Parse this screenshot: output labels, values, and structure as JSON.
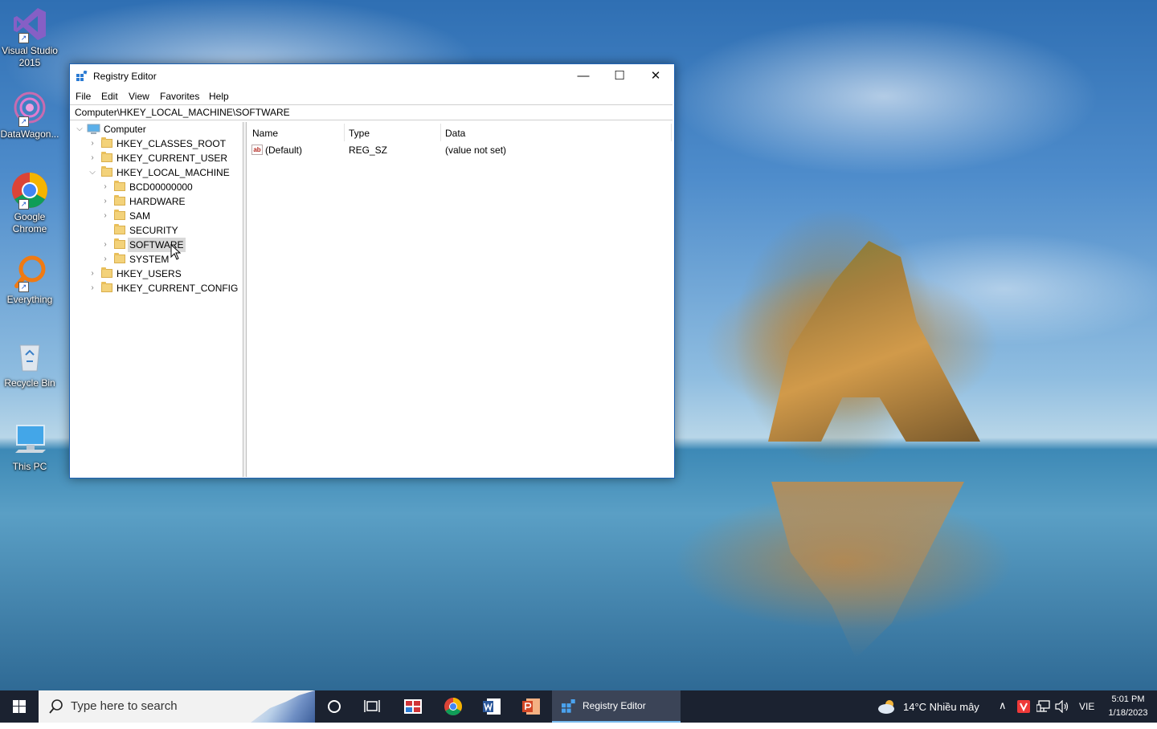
{
  "desktop": {
    "icons": [
      {
        "label": "Visual Studio 2015"
      },
      {
        "label": "DataWagon..."
      },
      {
        "label": "Google Chrome"
      },
      {
        "label": "Everything"
      },
      {
        "label": "Recycle Bin"
      },
      {
        "label": "This PC"
      }
    ]
  },
  "window": {
    "title": "Registry Editor",
    "minimize_glyph": "—",
    "maximize_glyph": "☐",
    "close_glyph": "✕",
    "menu": [
      "File",
      "Edit",
      "View",
      "Favorites",
      "Help"
    ],
    "address": "Computer\\HKEY_LOCAL_MACHINE\\SOFTWARE",
    "tree": {
      "root": "Computer",
      "hives": [
        "HKEY_CLASSES_ROOT",
        "HKEY_CURRENT_USER",
        "HKEY_LOCAL_MACHINE",
        "HKEY_USERS",
        "HKEY_CURRENT_CONFIG"
      ],
      "hklm_children": [
        "BCD00000000",
        "HARDWARE",
        "SAM",
        "SECURITY",
        "SOFTWARE",
        "SYSTEM"
      ],
      "selected": "SOFTWARE"
    },
    "list": {
      "columns": [
        "Name",
        "Type",
        "Data"
      ],
      "rows": [
        {
          "name": "(Default)",
          "type": "REG_SZ",
          "data": "(value not set)",
          "icon": "ab"
        }
      ]
    }
  },
  "taskbar": {
    "search_placeholder": "Type here to search",
    "active_app": "Registry Editor",
    "weather": "14°C  Nhiều mây",
    "language": "VIE",
    "time": "5:01 PM",
    "date": "1/18/2023"
  }
}
